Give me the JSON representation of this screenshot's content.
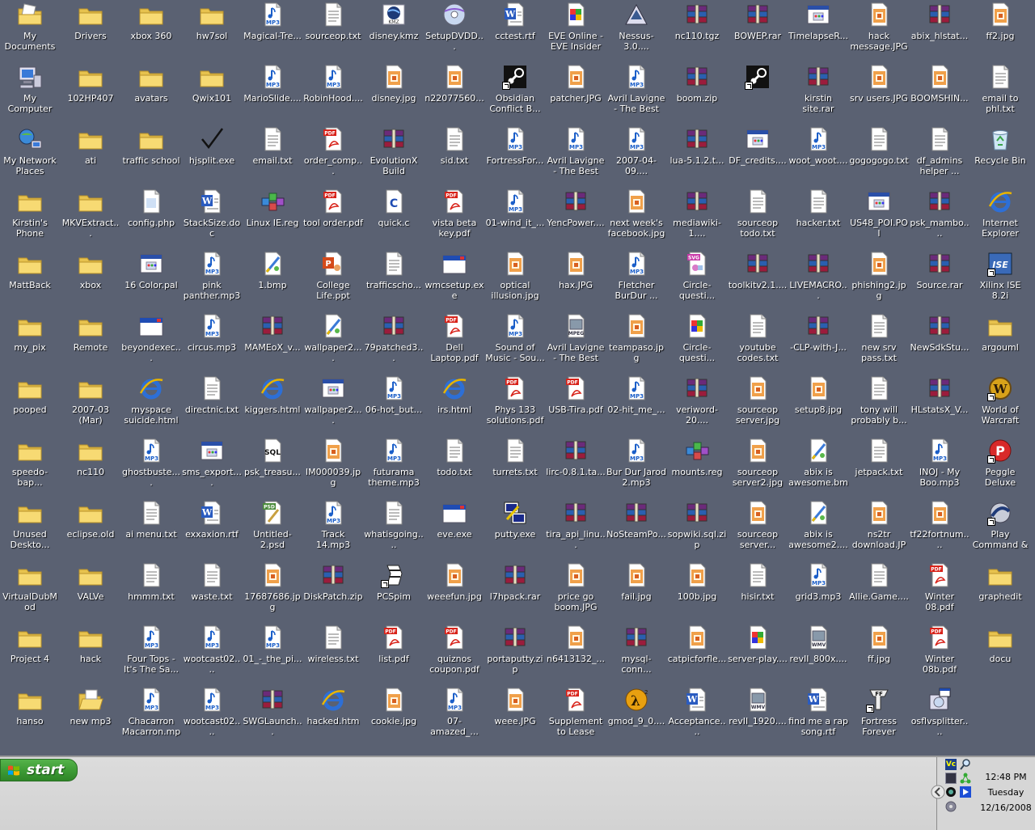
{
  "desktop": {
    "icons": [
      {
        "label": "My Documents",
        "type": "mydocs"
      },
      {
        "label": "Drivers",
        "type": "folder"
      },
      {
        "label": "xbox 360",
        "type": "folder"
      },
      {
        "label": "hw7sol",
        "type": "folder"
      },
      {
        "label": "Magical-Tre...",
        "type": "mp3"
      },
      {
        "label": "sourceop.txt",
        "type": "txt"
      },
      {
        "label": "disney.kmz",
        "type": "kmz"
      },
      {
        "label": "SetupDVDD...",
        "type": "dvd"
      },
      {
        "label": "cctest.rtf",
        "type": "doc"
      },
      {
        "label": "EVE Online - EVE Insider ...",
        "type": "web"
      },
      {
        "label": "Nessus-3.0....",
        "type": "app"
      },
      {
        "label": "nc110.tgz",
        "type": "rar"
      },
      {
        "label": "BOWEP.rar",
        "type": "rar"
      },
      {
        "label": "TimelapseR...",
        "type": "exe"
      },
      {
        "label": "hack message.JPG",
        "type": "jpg"
      },
      {
        "label": "abix_hlstat...",
        "type": "rar"
      },
      {
        "label": "ff2.jpg",
        "type": "jpg"
      },
      {
        "label": "My Computer",
        "type": "computer"
      },
      {
        "label": "102HP407",
        "type": "folder"
      },
      {
        "label": "avatars",
        "type": "folder"
      },
      {
        "label": "Qwix101",
        "type": "folder"
      },
      {
        "label": "MarioSlide....",
        "type": "mp3"
      },
      {
        "label": "RobinHood....",
        "type": "mp3"
      },
      {
        "label": "disney.jpg",
        "type": "jpg"
      },
      {
        "label": "n22077560...",
        "type": "jpg"
      },
      {
        "label": "Obsidian Conflict B...",
        "type": "steam",
        "shortcut": true
      },
      {
        "label": "patcher.JPG",
        "type": "jpg"
      },
      {
        "label": "Avril Lavigne - The Best D...",
        "type": "mp3"
      },
      {
        "label": "boom.zip",
        "type": "rar"
      },
      {
        "label": "",
        "type": "steam",
        "shortcut": true
      },
      {
        "label": "kirstin site.rar",
        "type": "rar"
      },
      {
        "label": "srv users.JPG",
        "type": "jpg"
      },
      {
        "label": "BOOMSHIN...",
        "type": "jpg"
      },
      {
        "label": "email to phl.txt",
        "type": "txt"
      },
      {
        "label": "My Network Places",
        "type": "network"
      },
      {
        "label": "ati",
        "type": "folder"
      },
      {
        "label": "traffic school",
        "type": "folder"
      },
      {
        "label": "hjsplit.exe",
        "type": "check"
      },
      {
        "label": "email.txt",
        "type": "txt"
      },
      {
        "label": "order_comp...",
        "type": "pdf"
      },
      {
        "label": "EvolutionX Build 3935.rar",
        "type": "rar"
      },
      {
        "label": "sid.txt",
        "type": "txt"
      },
      {
        "label": "FortressFor...",
        "type": "mp3"
      },
      {
        "label": "Avril Lavigne - The Best D...",
        "type": "mp3"
      },
      {
        "label": "2007-04-09....",
        "type": "mp3"
      },
      {
        "label": "lua-5.1.2.t...",
        "type": "rar"
      },
      {
        "label": "DF_credits....",
        "type": "exe"
      },
      {
        "label": "woot_woot....",
        "type": "mp3"
      },
      {
        "label": "gogogogo.txt",
        "type": "txt"
      },
      {
        "label": "df_admins helper ...",
        "type": "txt"
      },
      {
        "label": "Recycle Bin",
        "type": "recycle"
      },
      {
        "label": "Kirstin's Phone",
        "type": "folder"
      },
      {
        "label": "MKVExtract...",
        "type": "folder"
      },
      {
        "label": "config.php",
        "type": "file"
      },
      {
        "label": "StackSize.doc",
        "type": "doc"
      },
      {
        "label": "Linux IE.reg",
        "type": "reg"
      },
      {
        "label": "tool order.pdf",
        "type": "pdf"
      },
      {
        "label": "quick.c",
        "type": "c"
      },
      {
        "label": "vista beta key.pdf",
        "type": "pdf"
      },
      {
        "label": "01-wind_it_...",
        "type": "mp3"
      },
      {
        "label": "YencPower....",
        "type": "rar"
      },
      {
        "label": "next week's facebook.jpg",
        "type": "jpg"
      },
      {
        "label": "mediawiki-1....",
        "type": "rar"
      },
      {
        "label": "sourceop todo.txt",
        "type": "txt"
      },
      {
        "label": "hacker.txt",
        "type": "txt"
      },
      {
        "label": "US48_POI.POI",
        "type": "exe"
      },
      {
        "label": "psk_mambo....",
        "type": "rar"
      },
      {
        "label": "Internet Explorer",
        "type": "ie"
      },
      {
        "label": "MattBack",
        "type": "folder"
      },
      {
        "label": "xbox",
        "type": "folder"
      },
      {
        "label": "16 Color.pal",
        "type": "exe"
      },
      {
        "label": "pink panther.mp3",
        "type": "mp3"
      },
      {
        "label": "1.bmp",
        "type": "bmp"
      },
      {
        "label": "College Life.ppt",
        "type": "ppt"
      },
      {
        "label": "trafficscho...",
        "type": "txt"
      },
      {
        "label": "wmcsetup.exe",
        "type": "window"
      },
      {
        "label": "optical illusion.jpg",
        "type": "jpg"
      },
      {
        "label": "hax.JPG",
        "type": "jpg"
      },
      {
        "label": "Fletcher BurDur ...",
        "type": "mp3"
      },
      {
        "label": "Circle-questi...",
        "type": "svg"
      },
      {
        "label": "toolkitv2.1....",
        "type": "rar"
      },
      {
        "label": "LIVEMACRO...",
        "type": "rar"
      },
      {
        "label": "phishing2.jpg",
        "type": "jpg"
      },
      {
        "label": "Source.rar",
        "type": "rar"
      },
      {
        "label": "Xilinx ISE 8.2i",
        "type": "ise",
        "shortcut": true
      },
      {
        "label": "my_pix",
        "type": "folder"
      },
      {
        "label": "Remote",
        "type": "folder"
      },
      {
        "label": "beyondexec...",
        "type": "window"
      },
      {
        "label": "circus.mp3",
        "type": "mp3"
      },
      {
        "label": "MAMEoX_v...",
        "type": "rar"
      },
      {
        "label": "wallpaper2....",
        "type": "bmp"
      },
      {
        "label": "79patched3...",
        "type": "rar"
      },
      {
        "label": "Dell Laptop.pdf",
        "type": "pdf"
      },
      {
        "label": "Sound of Music - Sou...",
        "type": "mp3"
      },
      {
        "label": "Avril Lavigne - The Best D...",
        "type": "mpeg"
      },
      {
        "label": "teampaso.jpg",
        "type": "jpg"
      },
      {
        "label": "Circle-questi...",
        "type": "web"
      },
      {
        "label": "youtube codes.txt",
        "type": "txt"
      },
      {
        "label": "-CLP-with-J...",
        "type": "rar"
      },
      {
        "label": "new srv pass.txt",
        "type": "txt"
      },
      {
        "label": "NewSdkStu...",
        "type": "rar"
      },
      {
        "label": "argouml",
        "type": "folder"
      },
      {
        "label": "pooped",
        "type": "folder"
      },
      {
        "label": "2007-03 (Mar)",
        "type": "folder"
      },
      {
        "label": "myspace suicide.html",
        "type": "ie"
      },
      {
        "label": "directnic.txt",
        "type": "txt"
      },
      {
        "label": "kiggers.html",
        "type": "ie"
      },
      {
        "label": "wallpaper2....",
        "type": "exe"
      },
      {
        "label": "06-hot_but...",
        "type": "mp3"
      },
      {
        "label": "irs.html",
        "type": "ie"
      },
      {
        "label": "Phys 133 solutions.pdf",
        "type": "pdf"
      },
      {
        "label": "USB-Tira.pdf",
        "type": "pdf"
      },
      {
        "label": "02-hit_me_...",
        "type": "mp3"
      },
      {
        "label": "veriword-20....",
        "type": "rar"
      },
      {
        "label": "sourceop server.jpg",
        "type": "jpg"
      },
      {
        "label": "setup8.jpg",
        "type": "jpg"
      },
      {
        "label": "tony will probably b...",
        "type": "txt"
      },
      {
        "label": "HLstatsX_V...",
        "type": "rar"
      },
      {
        "label": "World of Warcraft",
        "type": "wow",
        "shortcut": true
      },
      {
        "label": "speedo-bap...",
        "type": "folder"
      },
      {
        "label": "nc110",
        "type": "folder"
      },
      {
        "label": "ghostbuste....",
        "type": "mp3"
      },
      {
        "label": "sms_export....",
        "type": "exe"
      },
      {
        "label": "psk_treasu...",
        "type": "sql"
      },
      {
        "label": "IM000039.jpg",
        "type": "jpg"
      },
      {
        "label": "futurama theme.mp3",
        "type": "mp3"
      },
      {
        "label": "todo.txt",
        "type": "txt"
      },
      {
        "label": "turrets.txt",
        "type": "txt"
      },
      {
        "label": "lirc-0.8.1.ta...",
        "type": "rar"
      },
      {
        "label": "Bur Dur Jarod 2.mp3",
        "type": "mp3"
      },
      {
        "label": "mounts.reg",
        "type": "reg"
      },
      {
        "label": "sourceop server2.jpg",
        "type": "jpg"
      },
      {
        "label": "abix is awesome.bmp",
        "type": "bmp"
      },
      {
        "label": "jetpack.txt",
        "type": "txt"
      },
      {
        "label": "INOJ - My Boo.mp3",
        "type": "mp3"
      },
      {
        "label": "Peggle Deluxe",
        "type": "peggle",
        "shortcut": true
      },
      {
        "label": "Unused Deskto...",
        "type": "folder"
      },
      {
        "label": "eclipse.old",
        "type": "folder"
      },
      {
        "label": "ai menu.txt",
        "type": "txt"
      },
      {
        "label": "exxaxion.rtf",
        "type": "doc"
      },
      {
        "label": "Untitled-2.psd",
        "type": "psd"
      },
      {
        "label": "Track 14.mp3",
        "type": "mp3"
      },
      {
        "label": "whatisgoing....",
        "type": "txt"
      },
      {
        "label": "eve.exe",
        "type": "window"
      },
      {
        "label": "putty.exe",
        "type": "putty"
      },
      {
        "label": "tira_api_linu...",
        "type": "rar"
      },
      {
        "label": "NoSteamPo...",
        "type": "rar"
      },
      {
        "label": "sopwiki.sql.zip",
        "type": "rar"
      },
      {
        "label": "sourceop server...",
        "type": "jpg"
      },
      {
        "label": "abix is awesome2....",
        "type": "bmp"
      },
      {
        "label": "ns2tr download.JPG",
        "type": "jpg"
      },
      {
        "label": "tf22fortnum....",
        "type": "jpg"
      },
      {
        "label": "Play Command & Conquer ...",
        "type": "cnc",
        "shortcut": true
      },
      {
        "label": "VirtualDubMod",
        "type": "folder"
      },
      {
        "label": "VALVe",
        "type": "folder"
      },
      {
        "label": "hmmm.txt",
        "type": "txt"
      },
      {
        "label": "waste.txt",
        "type": "txt"
      },
      {
        "label": "17687686.jpg",
        "type": "jpg"
      },
      {
        "label": "DiskPatch.zip",
        "type": "rar"
      },
      {
        "label": "PCSpim",
        "type": "pcspim",
        "shortcut": true
      },
      {
        "label": "weeefun.jpg",
        "type": "jpg"
      },
      {
        "label": "l7hpack.rar",
        "type": "rar"
      },
      {
        "label": "price go boom.JPG",
        "type": "jpg"
      },
      {
        "label": "fail.jpg",
        "type": "jpg"
      },
      {
        "label": "100b.jpg",
        "type": "jpg"
      },
      {
        "label": "hisir.txt",
        "type": "txt"
      },
      {
        "label": "grid3.mp3",
        "type": "mp3"
      },
      {
        "label": "Allie.Game....",
        "type": "txt"
      },
      {
        "label": "Winter 08.pdf",
        "type": "pdf"
      },
      {
        "label": "graphedit",
        "type": "folder"
      },
      {
        "label": "Project 4",
        "type": "folder"
      },
      {
        "label": "hack",
        "type": "folder"
      },
      {
        "label": "Four Tops - It's The Sa...",
        "type": "mp3"
      },
      {
        "label": "wootcast02....",
        "type": "mp3"
      },
      {
        "label": "01_-_the_pi...",
        "type": "mp3"
      },
      {
        "label": "wireless.txt",
        "type": "txt"
      },
      {
        "label": "list.pdf",
        "type": "pdf"
      },
      {
        "label": "quiznos coupon.pdf",
        "type": "pdf"
      },
      {
        "label": "portaputty.zip",
        "type": "rar"
      },
      {
        "label": "n6413132_...",
        "type": "jpg"
      },
      {
        "label": "mysql-conn...",
        "type": "rar"
      },
      {
        "label": "catpicforfle...",
        "type": "jpg"
      },
      {
        "label": "server-play....",
        "type": "web"
      },
      {
        "label": "revII_800x....",
        "type": "wmv"
      },
      {
        "label": "ff.jpg",
        "type": "jpg"
      },
      {
        "label": "Winter 08b.pdf",
        "type": "pdf"
      },
      {
        "label": "docu",
        "type": "folder"
      },
      {
        "label": "hanso",
        "type": "folder"
      },
      {
        "label": "new mp3",
        "type": "folderopen"
      },
      {
        "label": "Chacarron Macarron.mp3",
        "type": "mp3"
      },
      {
        "label": "wootcast02....",
        "type": "mp3"
      },
      {
        "label": "SWGLaunch...",
        "type": "rar"
      },
      {
        "label": "hacked.htm",
        "type": "ie"
      },
      {
        "label": "cookie.jpg",
        "type": "jpg"
      },
      {
        "label": "07-amazed_...",
        "type": "mp3"
      },
      {
        "label": "weee.JPG",
        "type": "jpg"
      },
      {
        "label": "Supplement to Lease 2.pdf",
        "type": "pdf"
      },
      {
        "label": "gmod_9_0....",
        "type": "hl2"
      },
      {
        "label": "Acceptance....",
        "type": "doc"
      },
      {
        "label": "revII_1920....",
        "type": "wmv"
      },
      {
        "label": "find me a rap song.rtf",
        "type": "doc"
      },
      {
        "label": "Fortress Forever",
        "type": "ff",
        "shortcut": true
      },
      {
        "label": "osflvsplitter....",
        "type": "setup"
      }
    ]
  },
  "taskbar": {
    "start_label": "start",
    "clock": {
      "time": "12:48 PM",
      "day": "Tuesday",
      "date": "12/16/2008"
    },
    "tray_icons": [
      "vc-icon",
      "magnifier-icon",
      "vmware-icon",
      "network-icon",
      "messenger-icon",
      "media-icon",
      "speaker-icon"
    ]
  },
  "colors": {
    "desktop": "#5a6172",
    "folder": "#f5d66b",
    "start_green": "#3c9a34",
    "rar_red": "#9b1c3c"
  }
}
